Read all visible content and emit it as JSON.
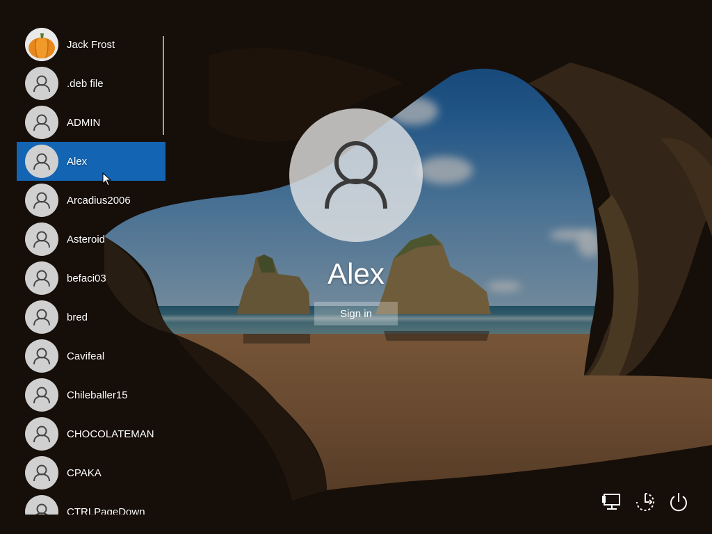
{
  "users": [
    {
      "name": "Jack Frost",
      "avatar": "pumpkin-picture"
    },
    {
      "name": ".deb file",
      "avatar": "default-user-icon"
    },
    {
      "name": "ADMIN",
      "avatar": "default-user-icon"
    },
    {
      "name": "Alex",
      "avatar": "default-user-icon",
      "selected": true
    },
    {
      "name": "Arcadius2006",
      "avatar": "default-user-icon"
    },
    {
      "name": "Asteroid",
      "avatar": "default-user-icon"
    },
    {
      "name": "befaci03",
      "avatar": "default-user-icon"
    },
    {
      "name": "bred",
      "avatar": "default-user-icon"
    },
    {
      "name": "Cavifeal",
      "avatar": "default-user-icon"
    },
    {
      "name": "Chileballer15",
      "avatar": "default-user-icon"
    },
    {
      "name": "CHOCOLATEMAN",
      "avatar": "default-user-icon"
    },
    {
      "name": "CPAKA",
      "avatar": "default-user-icon"
    },
    {
      "name": "CTRLPageDown",
      "avatar": "default-user-icon"
    }
  ],
  "selected_user": {
    "name": "Alex",
    "sign_in_label": "Sign in"
  },
  "system_buttons": [
    {
      "icon": "network-icon"
    },
    {
      "icon": "ease-of-access-icon"
    },
    {
      "icon": "power-icon"
    }
  ],
  "colors": {
    "selection": "#1464b4",
    "avatar_bg": "#d0d0d0"
  }
}
